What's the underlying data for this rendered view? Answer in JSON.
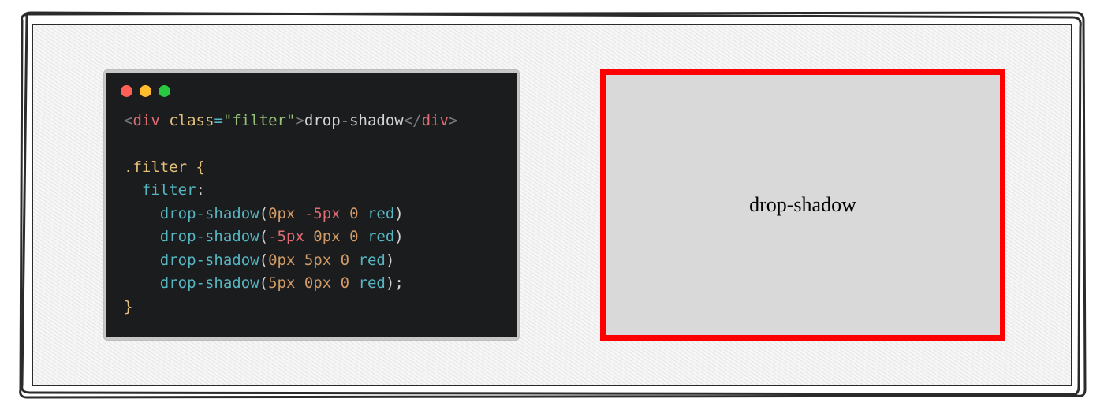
{
  "code": {
    "html_line": {
      "open_angle": "<",
      "tag": "div",
      "space": " ",
      "attr": "class",
      "eq": "=",
      "quote1": "\"",
      "str": "filter",
      "quote2": "\"",
      "close_angle": ">",
      "text": "drop-shadow",
      "end_open": "</",
      "end_tag": "div",
      "end_close": ">"
    },
    "css": {
      "selector": ".filter",
      "brace_open": " {",
      "prop": "filter",
      "colon": ":",
      "calls": [
        {
          "fn": "drop-shadow",
          "a1": "0px",
          "a2": "-5px",
          "a3": "0",
          "color": "red",
          "a2_neg": true
        },
        {
          "fn": "drop-shadow",
          "a1": "-5px",
          "a2": "0px",
          "a3": "0",
          "color": "red",
          "a1_neg": true
        },
        {
          "fn": "drop-shadow",
          "a1": "0px",
          "a2": "5px",
          "a3": "0",
          "color": "red"
        },
        {
          "fn": "drop-shadow",
          "a1": "5px",
          "a2": "0px",
          "a3": "0",
          "color": "red"
        }
      ],
      "semicolon": ";",
      "brace_close": "}"
    }
  },
  "preview": {
    "label": "drop-shadow"
  }
}
